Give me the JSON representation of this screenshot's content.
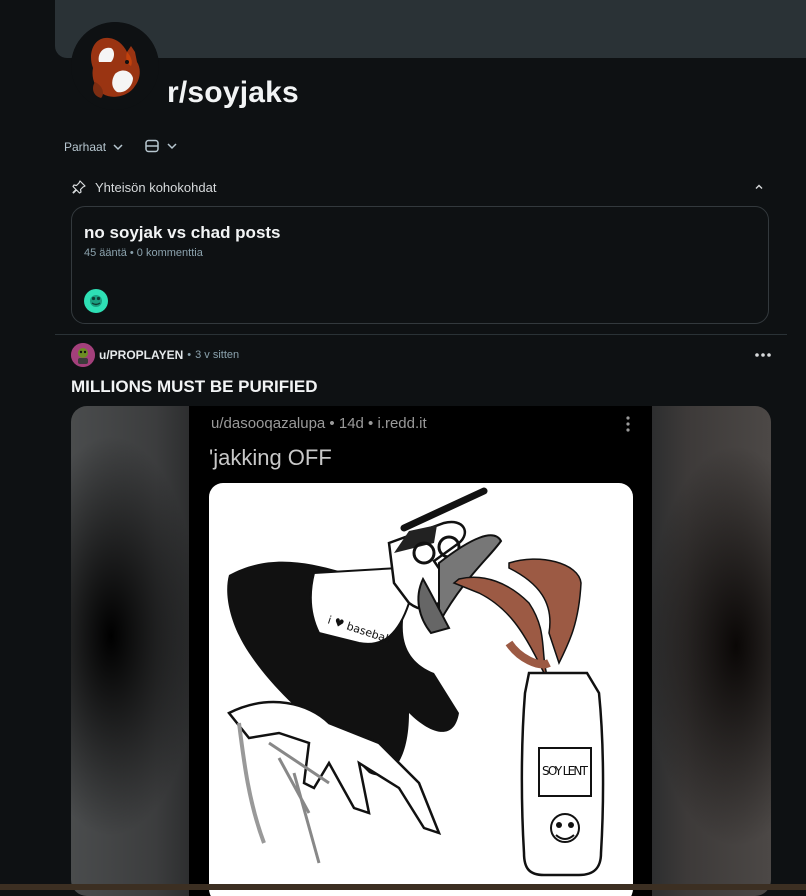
{
  "subreddit": {
    "name": "r/soyjaks",
    "avatar_icon": "squirrel-icon"
  },
  "toolbar": {
    "sort_label": "Parhaat",
    "view_icon": "card-view-icon"
  },
  "highlights": {
    "header": "Yhteisön kohokohdat",
    "card": {
      "title": "no soyjak vs chad posts",
      "meta": "45 ääntä • 0 kommenttia"
    }
  },
  "post": {
    "author": "u/PROPLAYEN",
    "separator": "•",
    "time": "3 v sitten",
    "title": "MILLIONS MUST BE PURIFIED",
    "media": {
      "inner_meta": "u/dasooqazalupa • 14d • i.redd.it",
      "inner_title": "'jakking OFF",
      "drawing_text_shirt": "i ♥ baseball",
      "drawing_text_can": "SOY LENT"
    }
  },
  "colors": {
    "background": "#0e1113",
    "banner": "#2a3236",
    "card_border": "#33393d",
    "meta_text": "#8ba2ad",
    "highlight_avatar": "#2ee0b5"
  }
}
